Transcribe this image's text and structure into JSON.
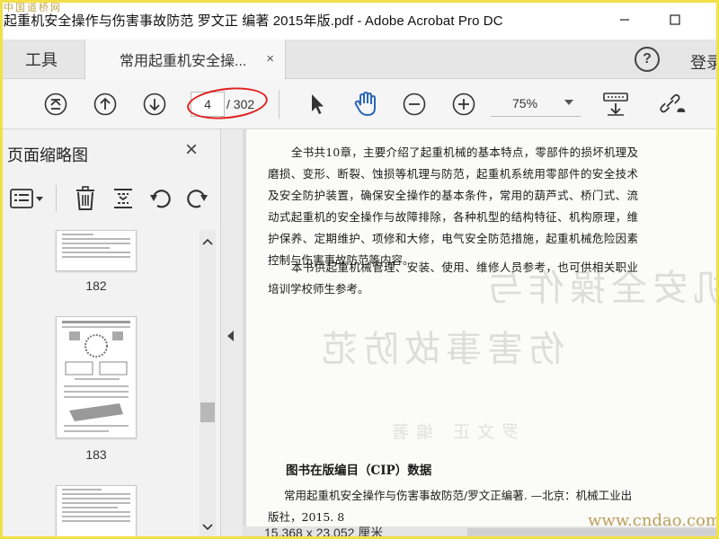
{
  "window": {
    "title": "起重机安全操作与伤害事故防范 罗文正 编著 2015年版.pdf - Adobe Acrobat Pro DC",
    "watermark_top": "中国道桥网",
    "minimize_icon": "minimize-icon",
    "maximize_icon": "maximize-icon"
  },
  "tabs": {
    "tools_label": "工具",
    "doc_tab_label": "常用起重机安全操...",
    "close_symbol": "×",
    "help_symbol": "?",
    "signin_label": "登录"
  },
  "toolbar": {
    "current_page": "4",
    "total_pages": "/ 302",
    "zoom": "75%",
    "icons": [
      "first-page-icon",
      "prev-page-icon",
      "next-page-icon",
      "select-arrow-icon",
      "hand-tool-icon",
      "zoom-out-icon",
      "zoom-in-icon",
      "scroll-mode-icon",
      "share-link-icon"
    ]
  },
  "sidebar": {
    "title": "页面缩略图",
    "close_symbol": "×",
    "tools": [
      "options-menu-icon",
      "delete-icon",
      "extract-icon",
      "rotate-left-icon",
      "rotate-right-icon"
    ],
    "thumbnails": [
      {
        "label": "182"
      },
      {
        "label": "183"
      },
      {
        "label": ""
      }
    ]
  },
  "document": {
    "paragraph_1": "全书共10章，主要介绍了起重机械的基本特点，零部件的损坏机理及磨损、变形、断裂、蚀损等机理与防范，起重机系统用零部件的安全技术及安全防护装置，确保安全操作的基本条件，常用的葫芦式、桥门式、流动式起重机的安全操作与故障排除，各种机型的结构特征、机构原理，维护保养、定期维护、项修和大修，电气安全防范措施，起重机械危险因素控制与伤害事故防范等内容。",
    "paragraph_2": "本书供起重机械管理、安装、使用、维修人员参考，也可供相关职业培训学校师生参考。",
    "ghost_line_1": "常用起重机安全操作与",
    "ghost_line_2": "伤害事故防范",
    "ghost_author": "罗文正 编著",
    "cip_title": "图书在版编目（CIP）数据",
    "cip_body": "常用起重机安全操作与伤害事故防范/罗文正编著. —北京：机械工业出版社，2015. 8"
  },
  "status": {
    "page_size": "15.368 x 23.052 厘米"
  },
  "watermark_bottom": "www.cndao.com",
  "colors": {
    "accent_blue": "#2a66b8",
    "annotation_red": "#e02020",
    "frame_yellow": "#f2e04a"
  }
}
